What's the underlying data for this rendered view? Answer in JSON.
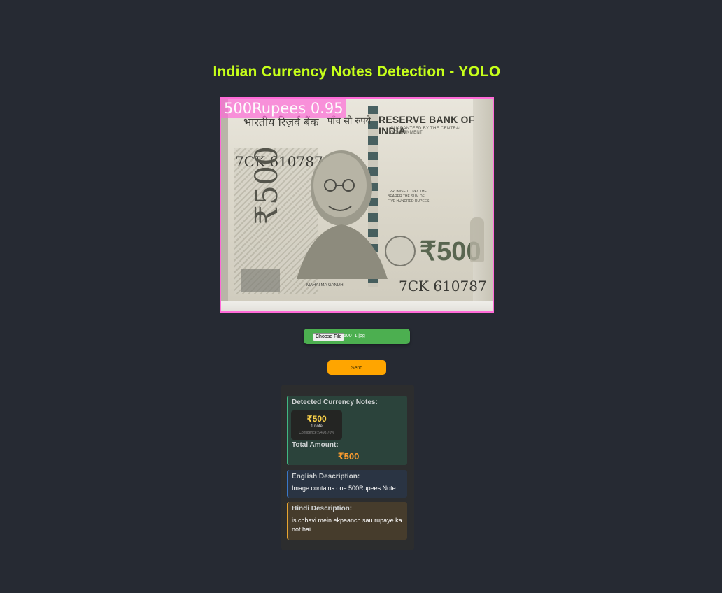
{
  "header": {
    "title": "Indian Currency Notes Detection - YOLO"
  },
  "result_image": {
    "detection_label": "500Rupees 0.95",
    "bank_name": "RESERVE BANK OF INDIA",
    "guarantee_text": "GUARANTEED BY THE CENTRAL GOVERNMENT",
    "hindi_top": "भारतीय रिज़र्व बैंक",
    "hindi_right": "पाँच सौ रुपये",
    "serial_number": "7CK 610787",
    "denomination_vertical": "₹500",
    "denomination_big": "₹500",
    "promise_text": "I PROMISE TO PAY THE BEARER THE SUM OF FIVE HUNDRED RUPEES",
    "portrait_caption": "MAHATMA GANDHI",
    "border_color": "#ff6bd8"
  },
  "upload": {
    "choose_file_label": "Choose File",
    "file_name": "500_1.jpg",
    "send_label": "Send"
  },
  "results": {
    "detected_heading": "Detected Currency Notes:",
    "note": {
      "amount": "₹500",
      "count": "1 note",
      "confidence": "Confidence: 9498.70%"
    },
    "total_label": "Total Amount:",
    "total_value": "₹500",
    "english_heading": "English Description:",
    "english_text": "Image contains one 500Rupees Note",
    "hindi_heading": "Hindi Description:",
    "hindi_text": "is chhavi mein ekpaanch sau rupaye ka not hai"
  },
  "colors": {
    "background": "#262a33",
    "title": "#c6ff1a",
    "file_bar": "#4caf50",
    "send_button": "#ffa500",
    "total_value": "#ff9d2e"
  }
}
